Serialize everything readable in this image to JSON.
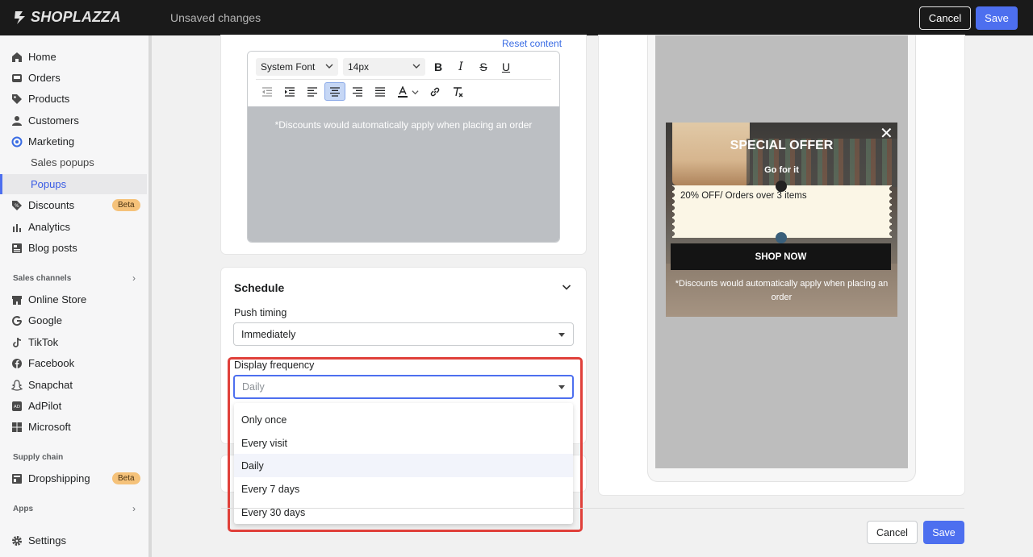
{
  "topbar": {
    "brand": "SHOPLAZZA",
    "status": "Unsaved changes",
    "cancel_label": "Cancel",
    "save_label": "Save"
  },
  "sidebar": {
    "items": [
      {
        "label": "Home",
        "icon": "home-icon"
      },
      {
        "label": "Orders",
        "icon": "orders-icon"
      },
      {
        "label": "Products",
        "icon": "tag-icon"
      },
      {
        "label": "Customers",
        "icon": "person-icon"
      },
      {
        "label": "Marketing",
        "icon": "marketing-icon"
      },
      {
        "label": "Sales popups"
      },
      {
        "label": "Popups"
      },
      {
        "label": "Discounts",
        "icon": "discount-icon",
        "badge": "Beta"
      },
      {
        "label": "Analytics",
        "icon": "analytics-icon"
      },
      {
        "label": "Blog posts",
        "icon": "blog-icon"
      }
    ],
    "sales_channels_title": "Sales channels",
    "channels": [
      {
        "label": "Online Store",
        "icon": "store-icon"
      },
      {
        "label": "Google",
        "icon": "google-icon"
      },
      {
        "label": "TikTok",
        "icon": "tiktok-icon"
      },
      {
        "label": "Facebook",
        "icon": "facebook-icon"
      },
      {
        "label": "Snapchat",
        "icon": "snapchat-icon"
      },
      {
        "label": "AdPilot",
        "icon": "adpilot-icon"
      },
      {
        "label": "Microsoft",
        "icon": "microsoft-icon"
      }
    ],
    "supply_chain_title": "Supply chain",
    "supply": [
      {
        "label": "Dropshipping",
        "icon": "dropshipping-icon",
        "badge": "Beta"
      }
    ],
    "apps_title": "Apps",
    "settings_label": "Settings"
  },
  "editor": {
    "reset_label": "Reset content",
    "font_family": "System Font",
    "font_size": "14px",
    "body_text": "*Discounts would automatically apply when placing an order"
  },
  "schedule": {
    "title": "Schedule",
    "push_timing_label": "Push timing",
    "push_timing_value": "Immediately",
    "display_frequency_label": "Display frequency",
    "display_frequency_value": "Daily",
    "options": [
      "Only once",
      "Every visit",
      "Daily",
      "Every 7 days",
      "Every 30 days"
    ]
  },
  "preview": {
    "title": "SPECIAL OFFER",
    "subtitle": "Go for it",
    "coupon_text": "20% OFF/ Orders over 3 items",
    "button_label": "SHOP NOW",
    "footer_text": "*Discounts would automatically apply when placing an order"
  },
  "footer": {
    "cancel_label": "Cancel",
    "save_label": "Save"
  },
  "colors": {
    "accent": "#4d6fef",
    "highlight": "#e0403a",
    "badge": "#f5c27a"
  }
}
